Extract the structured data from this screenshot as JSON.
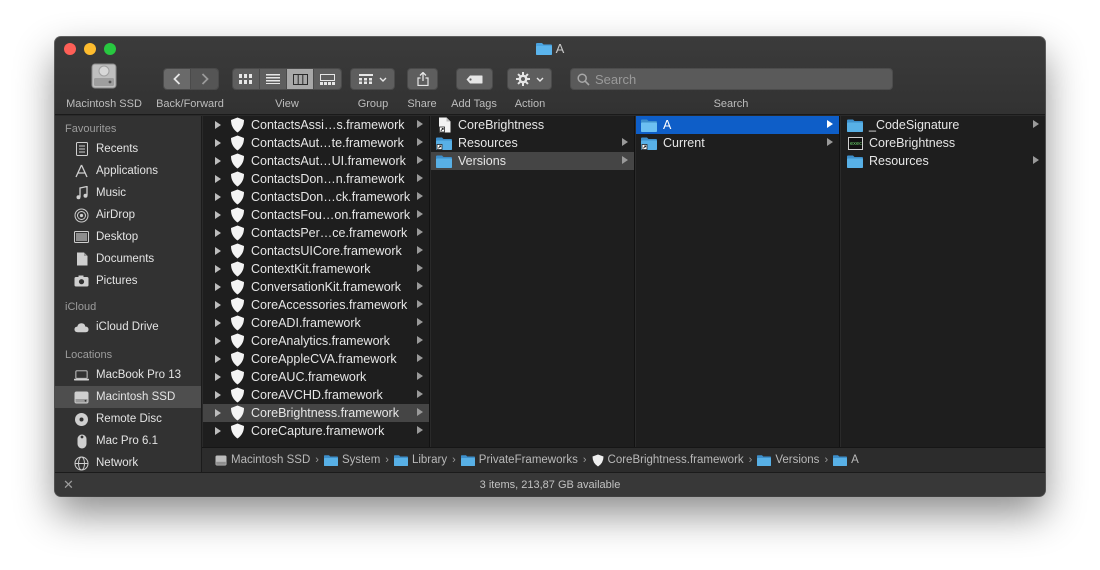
{
  "window": {
    "title": "A"
  },
  "toolbar": {
    "device_label": "Macintosh SSD",
    "back_forward_label": "Back/Forward",
    "view_label": "View",
    "group_label": "Group",
    "share_label": "Share",
    "add_tags_label": "Add Tags",
    "action_label": "Action",
    "search_label": "Search",
    "search_placeholder": "Search",
    "active_view": "column"
  },
  "sidebar": {
    "favourites_header": "Favourites",
    "favourites": [
      {
        "label": "Recents",
        "icon": "recents-icon"
      },
      {
        "label": "Applications",
        "icon": "applications-icon"
      },
      {
        "label": "Music",
        "icon": "music-icon"
      },
      {
        "label": "AirDrop",
        "icon": "airdrop-icon"
      },
      {
        "label": "Desktop",
        "icon": "desktop-icon"
      },
      {
        "label": "Documents",
        "icon": "documents-icon"
      },
      {
        "label": "Pictures",
        "icon": "pictures-icon"
      }
    ],
    "icloud_header": "iCloud",
    "icloud": [
      {
        "label": "iCloud Drive",
        "icon": "cloud-icon"
      }
    ],
    "locations_header": "Locations",
    "locations": [
      {
        "label": "MacBook Pro 13",
        "icon": "laptop-icon"
      },
      {
        "label": "Macintosh SSD",
        "icon": "disk-icon",
        "selected": true
      },
      {
        "label": "Remote Disc",
        "icon": "remote-disc-icon"
      },
      {
        "label": "Mac Pro 6.1",
        "icon": "mac-pro-icon"
      },
      {
        "label": "Network",
        "icon": "network-icon"
      }
    ]
  },
  "columns": {
    "frameworks": [
      "ContactsAssi…s.framework",
      "ContactsAut…te.framework",
      "ContactsAut…UI.framework",
      "ContactsDon…n.framework",
      "ContactsDon…ck.framework",
      "ContactsFou…on.framework",
      "ContactsPer…ce.framework",
      "ContactsUICore.framework",
      "ContextKit.framework",
      "ConversationKit.framework",
      "CoreAccessories.framework",
      "CoreADI.framework",
      "CoreAnalytics.framework",
      "CoreAppleCVA.framework",
      "CoreAUC.framework",
      "CoreAVCHD.framework",
      "CoreBrightness.framework",
      "CoreCapture.framework"
    ],
    "frameworks_selected": "CoreBrightness.framework",
    "bundle": [
      {
        "label": "CoreBrightness",
        "icon": "alias-file-icon",
        "folder": false
      },
      {
        "label": "Resources",
        "icon": "alias-folder-icon",
        "folder": true
      },
      {
        "label": "Versions",
        "icon": "folder-icon",
        "folder": true,
        "selected": true
      }
    ],
    "versions": [
      {
        "label": "A",
        "icon": "folder-icon",
        "folder": true,
        "selected": true
      },
      {
        "label": "Current",
        "icon": "alias-folder-icon",
        "folder": true
      }
    ],
    "contents": [
      {
        "label": "_CodeSignature",
        "icon": "folder-icon",
        "folder": true
      },
      {
        "label": "CoreBrightness",
        "icon": "exec-icon",
        "folder": false
      },
      {
        "label": "Resources",
        "icon": "folder-icon",
        "folder": true
      }
    ]
  },
  "path": [
    {
      "label": "Macintosh SSD",
      "icon": "disk-icon"
    },
    {
      "label": "System",
      "icon": "folder-icon"
    },
    {
      "label": "Library",
      "icon": "folder-icon"
    },
    {
      "label": "PrivateFrameworks",
      "icon": "folder-icon"
    },
    {
      "label": "CoreBrightness.framework",
      "icon": "framework-icon"
    },
    {
      "label": "Versions",
      "icon": "folder-icon"
    },
    {
      "label": "A",
      "icon": "folder-icon"
    }
  ],
  "status": {
    "text": "3 items, 213,87 GB available"
  },
  "colors": {
    "selection_blue": "#0e5ec8",
    "folder_blue": "#4aa3df",
    "inactive_selection": "#454545"
  }
}
